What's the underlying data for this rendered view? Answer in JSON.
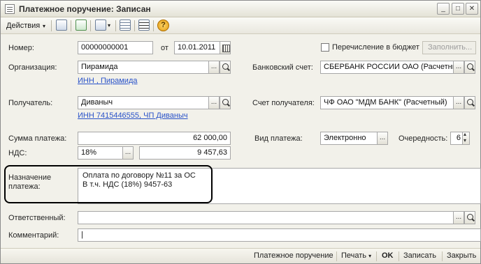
{
  "window": {
    "title": "Платежное поручение: Записан",
    "min_glyph": "_",
    "max_glyph": "□",
    "close_glyph": "✕"
  },
  "toolbar": {
    "actions_label": "Действия",
    "actions_caret": "▾",
    "help_glyph": "?"
  },
  "form": {
    "number_label": "Номер:",
    "number_value": "00000000001",
    "date_prefix": "от",
    "date_value": "10.01.2011",
    "budget_checkbox_label": "Перечисление в бюджет",
    "fill_button_label": "Заполнить...",
    "organization_label": "Организация:",
    "organization_value": "Пирамида",
    "organization_inn_link": "ИНН , Пирамида",
    "bank_account_label": "Банковский счет:",
    "bank_account_value": "СБЕРБАНК РОССИИ ОАО (Расчетнь",
    "recipient_label": "Получатель:",
    "recipient_value": "Диваныч",
    "recipient_inn_link": "ИНН 7415446555, ЧП Диваныч",
    "recipient_account_label": "Счет получателя:",
    "recipient_account_value": "ЧФ ОАО \"МДМ БАНК\" (Расчетный)",
    "amount_label": "Сумма платежа:",
    "amount_value": "62 000,00",
    "payment_type_label": "Вид платежа:",
    "payment_type_value": "Электронно",
    "priority_label": "Очередность:",
    "priority_value": "6",
    "vat_label": "НДС:",
    "vat_rate_value": "18%",
    "vat_amount_value": "9 457,63",
    "purpose_label_line1": "Назначение",
    "purpose_label_line2": "платежа:",
    "purpose_line1": "Оплата по договору №11 за ОС",
    "purpose_line2": "В т.ч. НДС  (18%) 9457-63",
    "responsible_label": "Ответственный:",
    "responsible_value": "",
    "comment_label": "Комментарий:",
    "comment_value": "",
    "select_glyph": "...",
    "comment_cursor": "|"
  },
  "bottom": {
    "print_form_label": "Платежное поручение",
    "print_label": "Печать",
    "print_caret": "▾",
    "ok_label": "OK",
    "save_label": "Записать",
    "close_label": "Закрыть"
  }
}
